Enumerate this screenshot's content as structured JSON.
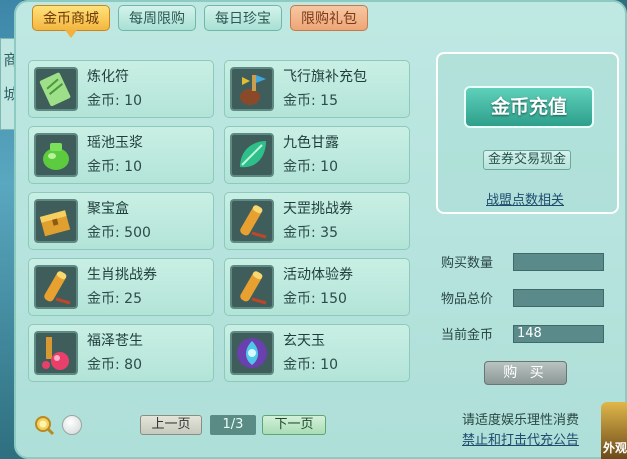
{
  "side_tab": {
    "chars": [
      "商",
      "城"
    ]
  },
  "tabs": [
    {
      "label": "金币商城"
    },
    {
      "label": "每周限购"
    },
    {
      "label": "每日珍宝"
    },
    {
      "label": "限购礼包"
    }
  ],
  "items": [
    {
      "name": "炼化符",
      "price": "金币: 10",
      "icon": "talisman-icon"
    },
    {
      "name": "飞行旗补充包",
      "price": "金币: 15",
      "icon": "flag-pouch-icon"
    },
    {
      "name": "瑶池玉浆",
      "price": "金币: 10",
      "icon": "jade-jar-icon"
    },
    {
      "name": "九色甘露",
      "price": "金币: 10",
      "icon": "dew-leaf-icon"
    },
    {
      "name": "聚宝盒",
      "price": "金币: 500",
      "icon": "treasure-box-icon"
    },
    {
      "name": "天罡挑战券",
      "price": "金币: 35",
      "icon": "scroll-icon"
    },
    {
      "name": "生肖挑战券",
      "price": "金币: 25",
      "icon": "scroll-icon"
    },
    {
      "name": "活动体验券",
      "price": "金币: 150",
      "icon": "scroll-icon"
    },
    {
      "name": "福泽苍生",
      "price": "金币: 80",
      "icon": "potion-icon"
    },
    {
      "name": "玄天玉",
      "price": "金币: 10",
      "icon": "gem-icon"
    }
  ],
  "right": {
    "recharge": "金币充值",
    "exchange": "金券交易现金",
    "alliance_link": "战盟点数相关",
    "buy_qty_label": "购买数量",
    "buy_qty_value": "",
    "total_label": "物品总价",
    "total_value": "",
    "current_label": "当前金币",
    "current_value": "148",
    "buy": "购 买"
  },
  "pager": {
    "prev": "上一页",
    "indicator": "1/3",
    "next": "下一页"
  },
  "footer": {
    "notice": "请适度娱乐理性消费",
    "link": "禁止和打击代充公告",
    "outlook": "外观"
  }
}
